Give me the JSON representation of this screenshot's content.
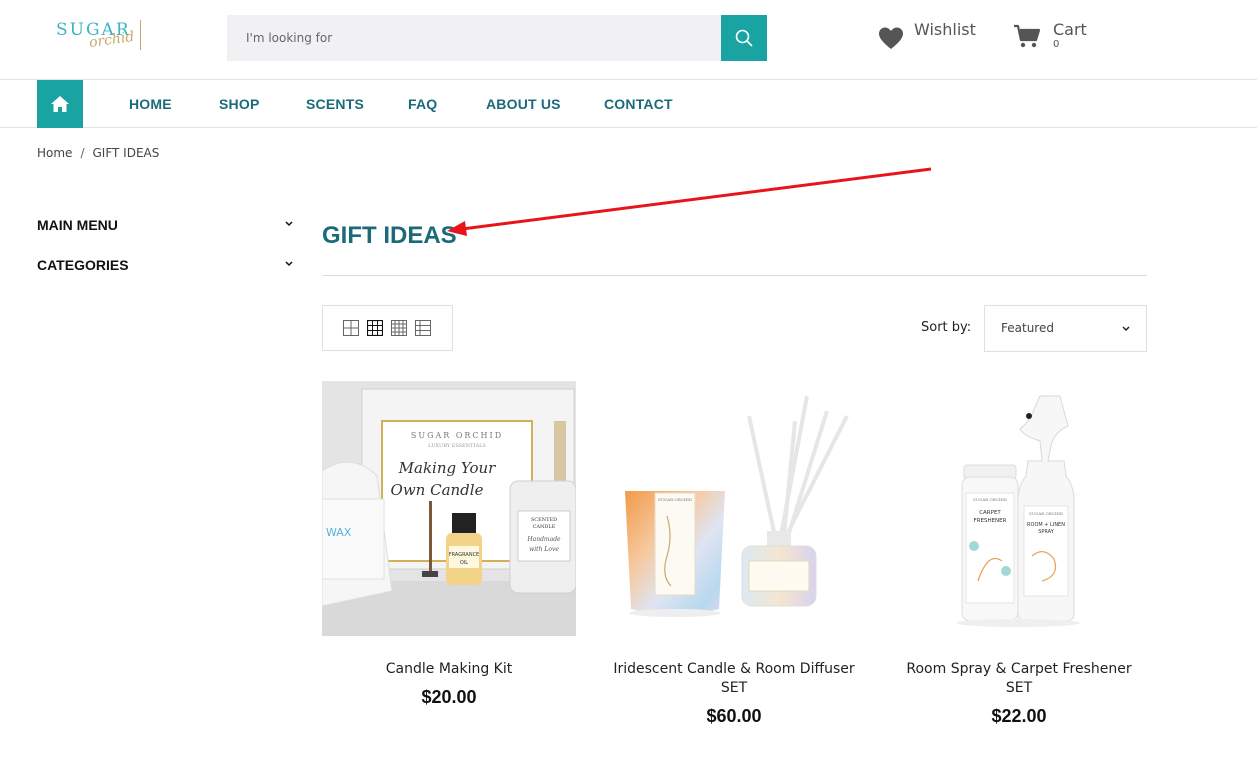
{
  "header": {
    "logo": {
      "line1": "SUGAR",
      "line2": "orchid"
    },
    "search": {
      "placeholder": "I'm looking for"
    },
    "wishlist_label": "Wishlist",
    "cart": {
      "label": "Cart",
      "count": "0"
    }
  },
  "nav": {
    "items": [
      {
        "label": "HOME"
      },
      {
        "label": "SHOP"
      },
      {
        "label": "SCENTS"
      },
      {
        "label": "FAQ"
      },
      {
        "label": "ABOUT US"
      },
      {
        "label": "CONTACT"
      }
    ]
  },
  "breadcrumb": {
    "home": "Home",
    "separator": "/",
    "current": "GIFT IDEAS"
  },
  "sidebar": {
    "items": [
      {
        "label": "MAIN MENU"
      },
      {
        "label": "CATEGORIES"
      }
    ]
  },
  "main": {
    "title": "GIFT IDEAS",
    "sort": {
      "label": "Sort by:",
      "value": "Featured"
    },
    "products": [
      {
        "name": "Candle Making Kit",
        "price": "$20.00",
        "image_texts": {
          "box_brand": "SUGAR ORCHID",
          "box_sub": "LUXURY ESSENTIALS",
          "box_title_1": "Making Your",
          "box_title_2": "Own Candle",
          "wax": "WAX",
          "oil_1": "FRAGRANCE",
          "oil_2": "OIL",
          "jar_1": "SCENTED",
          "jar_2": "CANDLE",
          "jar_3": "Handmade",
          "jar_4": "with Love"
        }
      },
      {
        "name": "Iridescent Candle & Room Diffuser SET",
        "price": "$60.00",
        "image_texts": {
          "brand": "SUGAR ORCHID"
        }
      },
      {
        "name": "Room Spray & Carpet Freshener SET",
        "price": "$22.00",
        "image_texts": {
          "brand": "SUGAR ORCHID",
          "carpet_1": "CARPET",
          "carpet_2": "FRESHENER",
          "spray_1": "ROOM + LINEN",
          "spray_2": "SPRAY"
        }
      }
    ]
  },
  "colors": {
    "accent": "#1aa3a3",
    "nav_text": "#1b6a7a",
    "annotation_arrow": "#e8141b"
  },
  "icons": {
    "search": "search-icon",
    "wishlist": "heart-icon",
    "cart": "cart-icon",
    "home": "home-icon",
    "chevron": "chevron-down-icon"
  }
}
